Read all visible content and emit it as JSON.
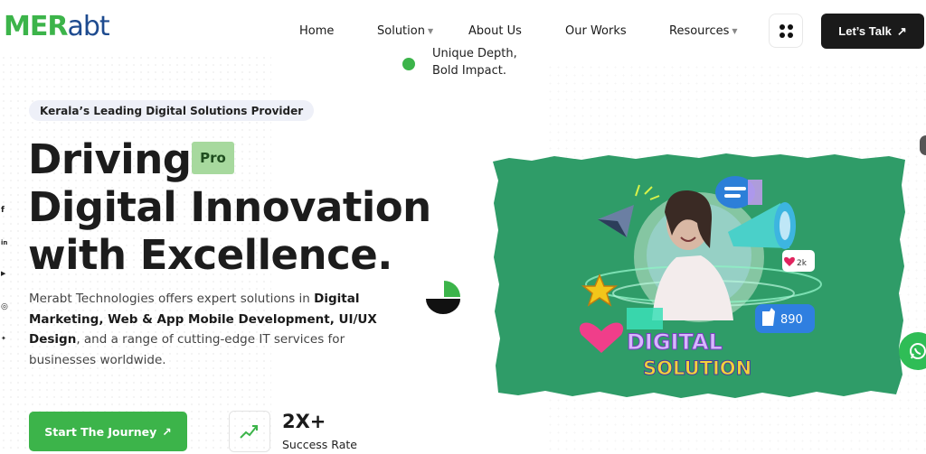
{
  "brand": {
    "logo_part1": "MER",
    "logo_part2": "abt"
  },
  "nav": {
    "items": [
      {
        "label": "Home"
      },
      {
        "label": "Solution"
      },
      {
        "label": "About Us"
      },
      {
        "label": "Our Works"
      },
      {
        "label": "Resources"
      }
    ],
    "cta_label": "Let’s Talk"
  },
  "tagline": {
    "line1": "Unique Depth,",
    "line2": "Bold Impact."
  },
  "hero": {
    "pill": "Kerala’s Leading Digital Solutions Provider",
    "headline_line1": "Driving",
    "headline_line2": "Digital Innovation",
    "headline_line3": "with Excellence.",
    "badge": "Pro",
    "desc_a": "Merabt Technologies offers expert solutions in ",
    "desc_b": "Digital Marketing, Web & App Mobile Development, UI/UX Design",
    "desc_c": ", and a range of cutting-edge IT services for businesses worldwide.",
    "cta_label": "Start The Journey",
    "stat_value": "2X+",
    "stat_label": "Success Rate"
  },
  "social": [
    "f",
    "in",
    "▶",
    "◎",
    "✦"
  ],
  "image": {
    "title_line1": "DIGITAL",
    "title_line2": "SOLUTION",
    "likes": "2k",
    "thumbs": "890"
  },
  "colors": {
    "brand_green": "#3cb44a",
    "brand_blue": "#1e4b8f",
    "dark": "#1a1a1a",
    "hero_bg": "#2f9c68"
  }
}
